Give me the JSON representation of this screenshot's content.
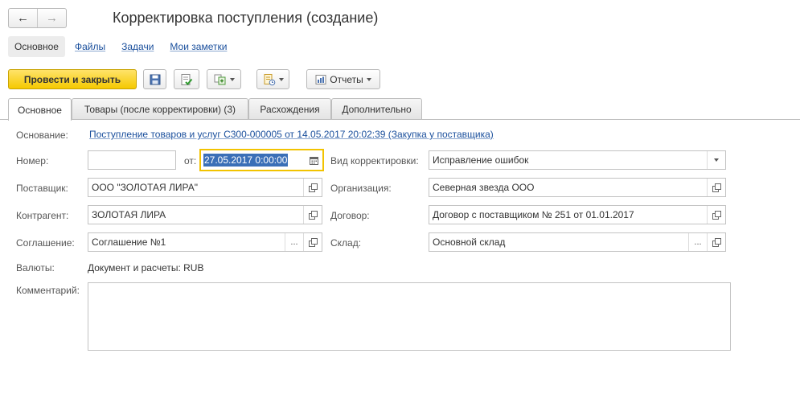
{
  "window": {
    "title": "Корректировка поступления (создание)",
    "back_icon": "←",
    "forward_icon": "→"
  },
  "sections": {
    "active": "Основное",
    "links": [
      "Файлы",
      "Задачи",
      "Мои заметки"
    ]
  },
  "toolbar": {
    "post_close_label": "Провести и закрыть",
    "reports_label": "Отчеты"
  },
  "tabs": [
    {
      "label": "Основное",
      "active": true
    },
    {
      "label": "Товары (после корректировки) (3)",
      "active": false
    },
    {
      "label": "Расхождения",
      "active": false
    },
    {
      "label": "Дополнительно",
      "active": false
    }
  ],
  "form": {
    "basis": {
      "label": "Основание:",
      "value": "Поступление товаров и услуг С300-000005 от 14.05.2017 20:02:39 (Закупка у поставщика)"
    },
    "number": {
      "label": "Номер:",
      "value": ""
    },
    "date": {
      "label": "от:",
      "value": "27.05.2017  0:00:00"
    },
    "correction_type": {
      "label": "Вид корректировки:",
      "value": "Исправление ошибок"
    },
    "supplier": {
      "label": "Поставщик:",
      "value": "ООО \"ЗОЛОТАЯ ЛИРА\""
    },
    "organization": {
      "label": "Организация:",
      "value": "Северная звезда ООО"
    },
    "counterparty": {
      "label": "Контрагент:",
      "value": "ЗОЛОТАЯ ЛИРА"
    },
    "contract": {
      "label": "Договор:",
      "value": "Договор с поставщиком № 251 от 01.01.2017"
    },
    "agreement": {
      "label": "Соглашение:",
      "value": "Соглашение №1"
    },
    "warehouse": {
      "label": "Склад:",
      "value": "Основной склад"
    },
    "currency": {
      "label": "Валюты:",
      "value": "Документ и расчеты: RUB"
    },
    "comment": {
      "label": "Комментарий:",
      "value": ""
    }
  },
  "colors": {
    "accent": "#f5c900",
    "link": "#1a4f9c",
    "selection": "#3a6fb7"
  }
}
